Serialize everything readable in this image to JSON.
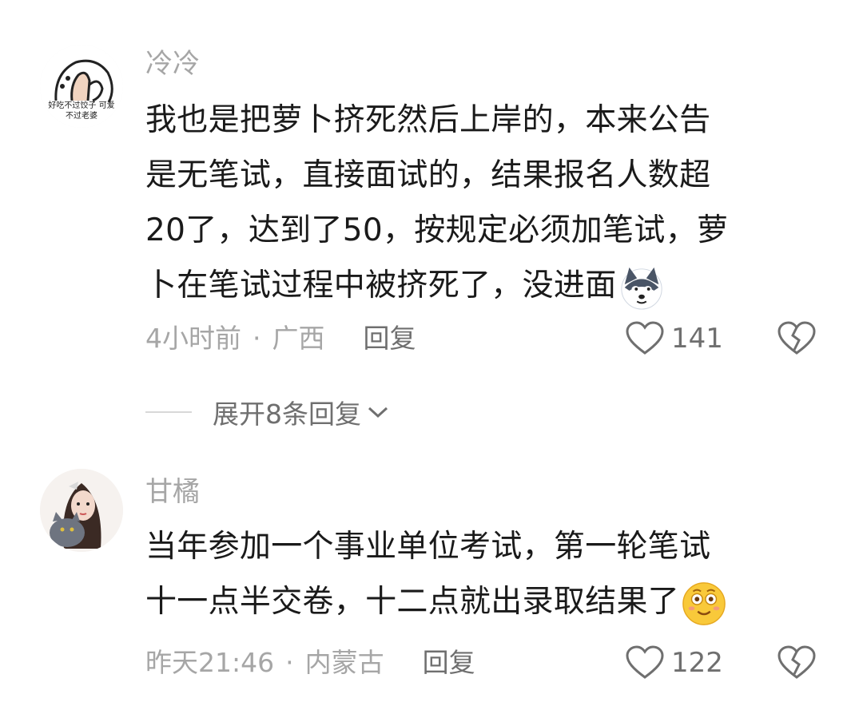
{
  "comments": [
    {
      "username": "冷冷",
      "avatar_text": "好吃不过饺子 可爱不过老婆",
      "lines": [
        "我也是把萝卜挤死然后上岸的，本来公告",
        "是无笔试，直接面试的，结果报名人数超",
        "20了，达到了50，按规定必须加笔试，萝",
        "卜在笔试过程中被挤死了，没进面"
      ],
      "end_emoji": "husky-dog-emoji",
      "time": "4小时前",
      "separator": "·",
      "location": "广西",
      "reply_label": "回复",
      "likes": "141",
      "expand_label": "展开8条回复"
    },
    {
      "username": "甘橘",
      "lines": [
        "当年参加一个事业单位考试，第一轮笔试",
        "十一点半交卷，十二点就出录取结果了"
      ],
      "end_emoji": "smiling-face-emoji",
      "time": "昨天21:46",
      "separator": "·",
      "location": "内蒙古",
      "reply_label": "回复",
      "likes": "122"
    }
  ],
  "colors": {
    "primary_text": "#1a1a1a",
    "secondary_text": "#a6a6a6",
    "action_text": "#6f6f6f"
  }
}
